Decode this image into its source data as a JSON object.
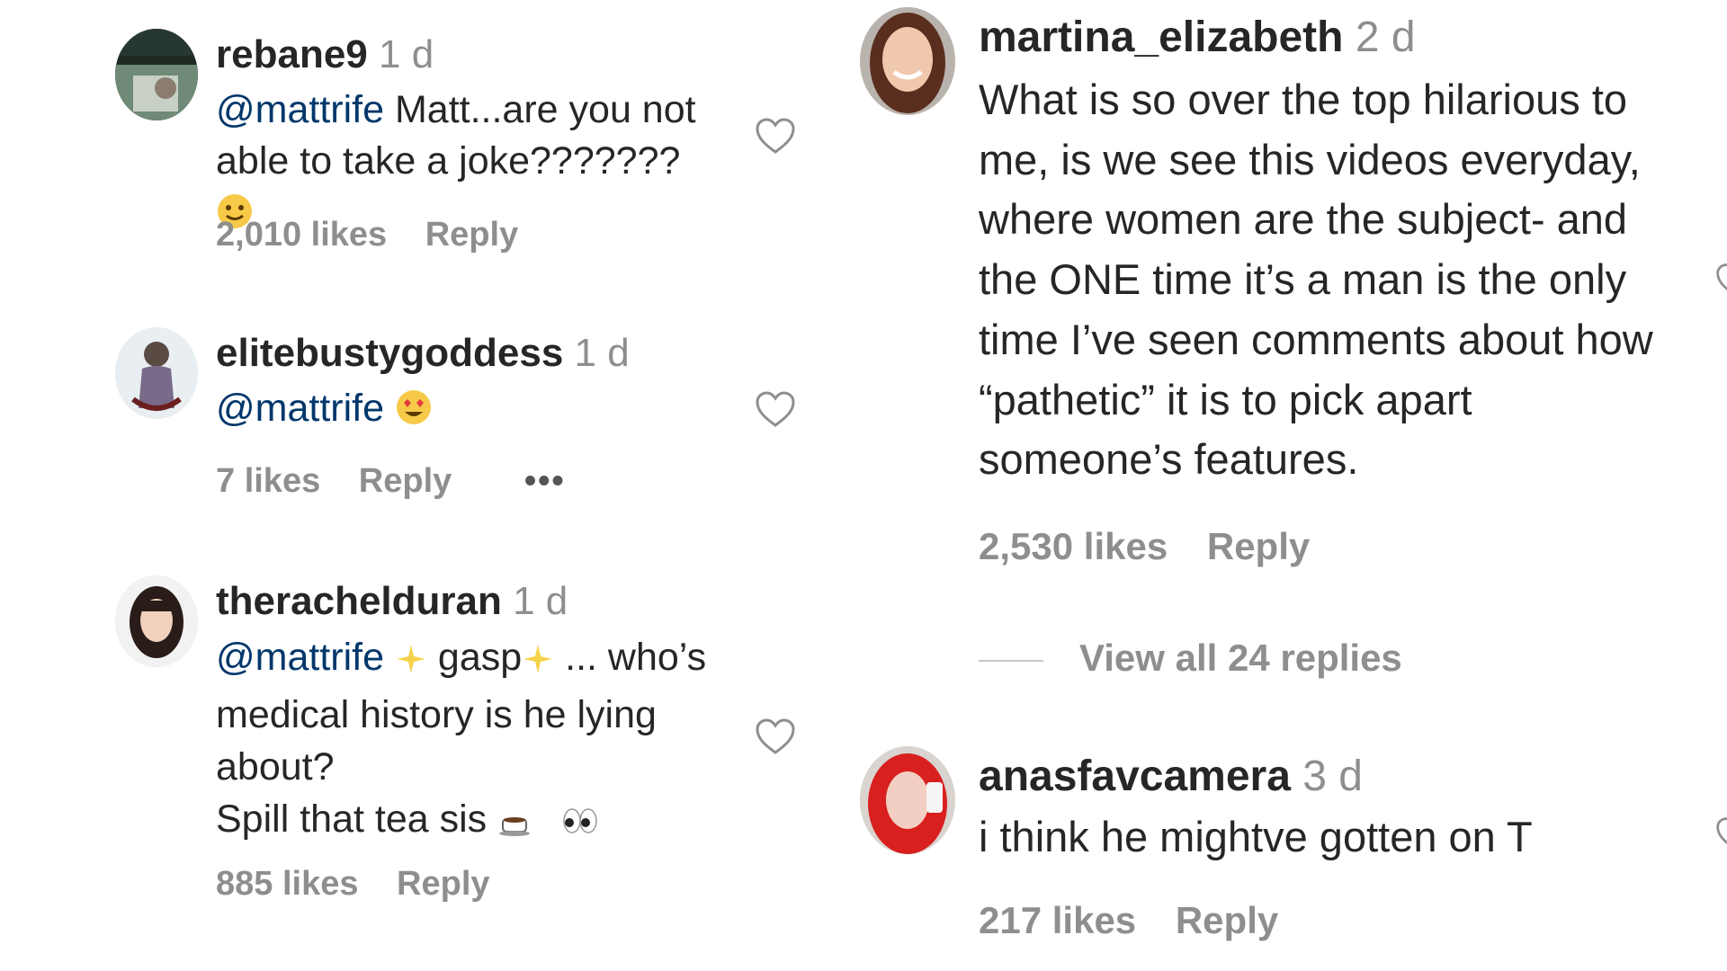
{
  "comments": [
    {
      "username": "rebane9",
      "time": "1 d",
      "mention": "@mattrife",
      "text": " Matt...are you not able to take a joke???????",
      "likes": "2,010 likes",
      "reply": "Reply"
    },
    {
      "username": "elitebustygoddess",
      "time": "1 d",
      "mention": "@mattrife",
      "text": "",
      "likes": "7 likes",
      "reply": "Reply",
      "more": "•••"
    },
    {
      "username": "therachelduran",
      "time": "1 d",
      "mention": "@mattrife",
      "text_a": " gasp",
      "text_b": " ... who’s medical history is he lying about?",
      "text_c": "Spill that tea sis",
      "likes": "885 likes",
      "reply": "Reply"
    },
    {
      "username": "martina_elizabeth",
      "time": "2 d",
      "text": "What is so over the top hilarious to me, is we see this videos everyday, where women are the subject- and the ONE time it’s a man is the only time I’ve seen comments about how “pathetic” it is to pick apart someone’s features.",
      "likes": "2,530 likes",
      "reply": "Reply",
      "view_replies": "View all 24 replies"
    },
    {
      "username": "anasfavcamera",
      "time": "3 d",
      "text": "i think he mightve gotten on T",
      "likes": "217 likes",
      "reply": "Reply"
    }
  ],
  "icons": [
    "heart-icon",
    "smile-emoji",
    "heart-eyes-emoji",
    "sparkles-emoji",
    "coffee-emoji",
    "eyes-emoji"
  ],
  "colors": {
    "text": "#262626",
    "secondary": "#8e8e8e",
    "mention": "#00376b"
  }
}
